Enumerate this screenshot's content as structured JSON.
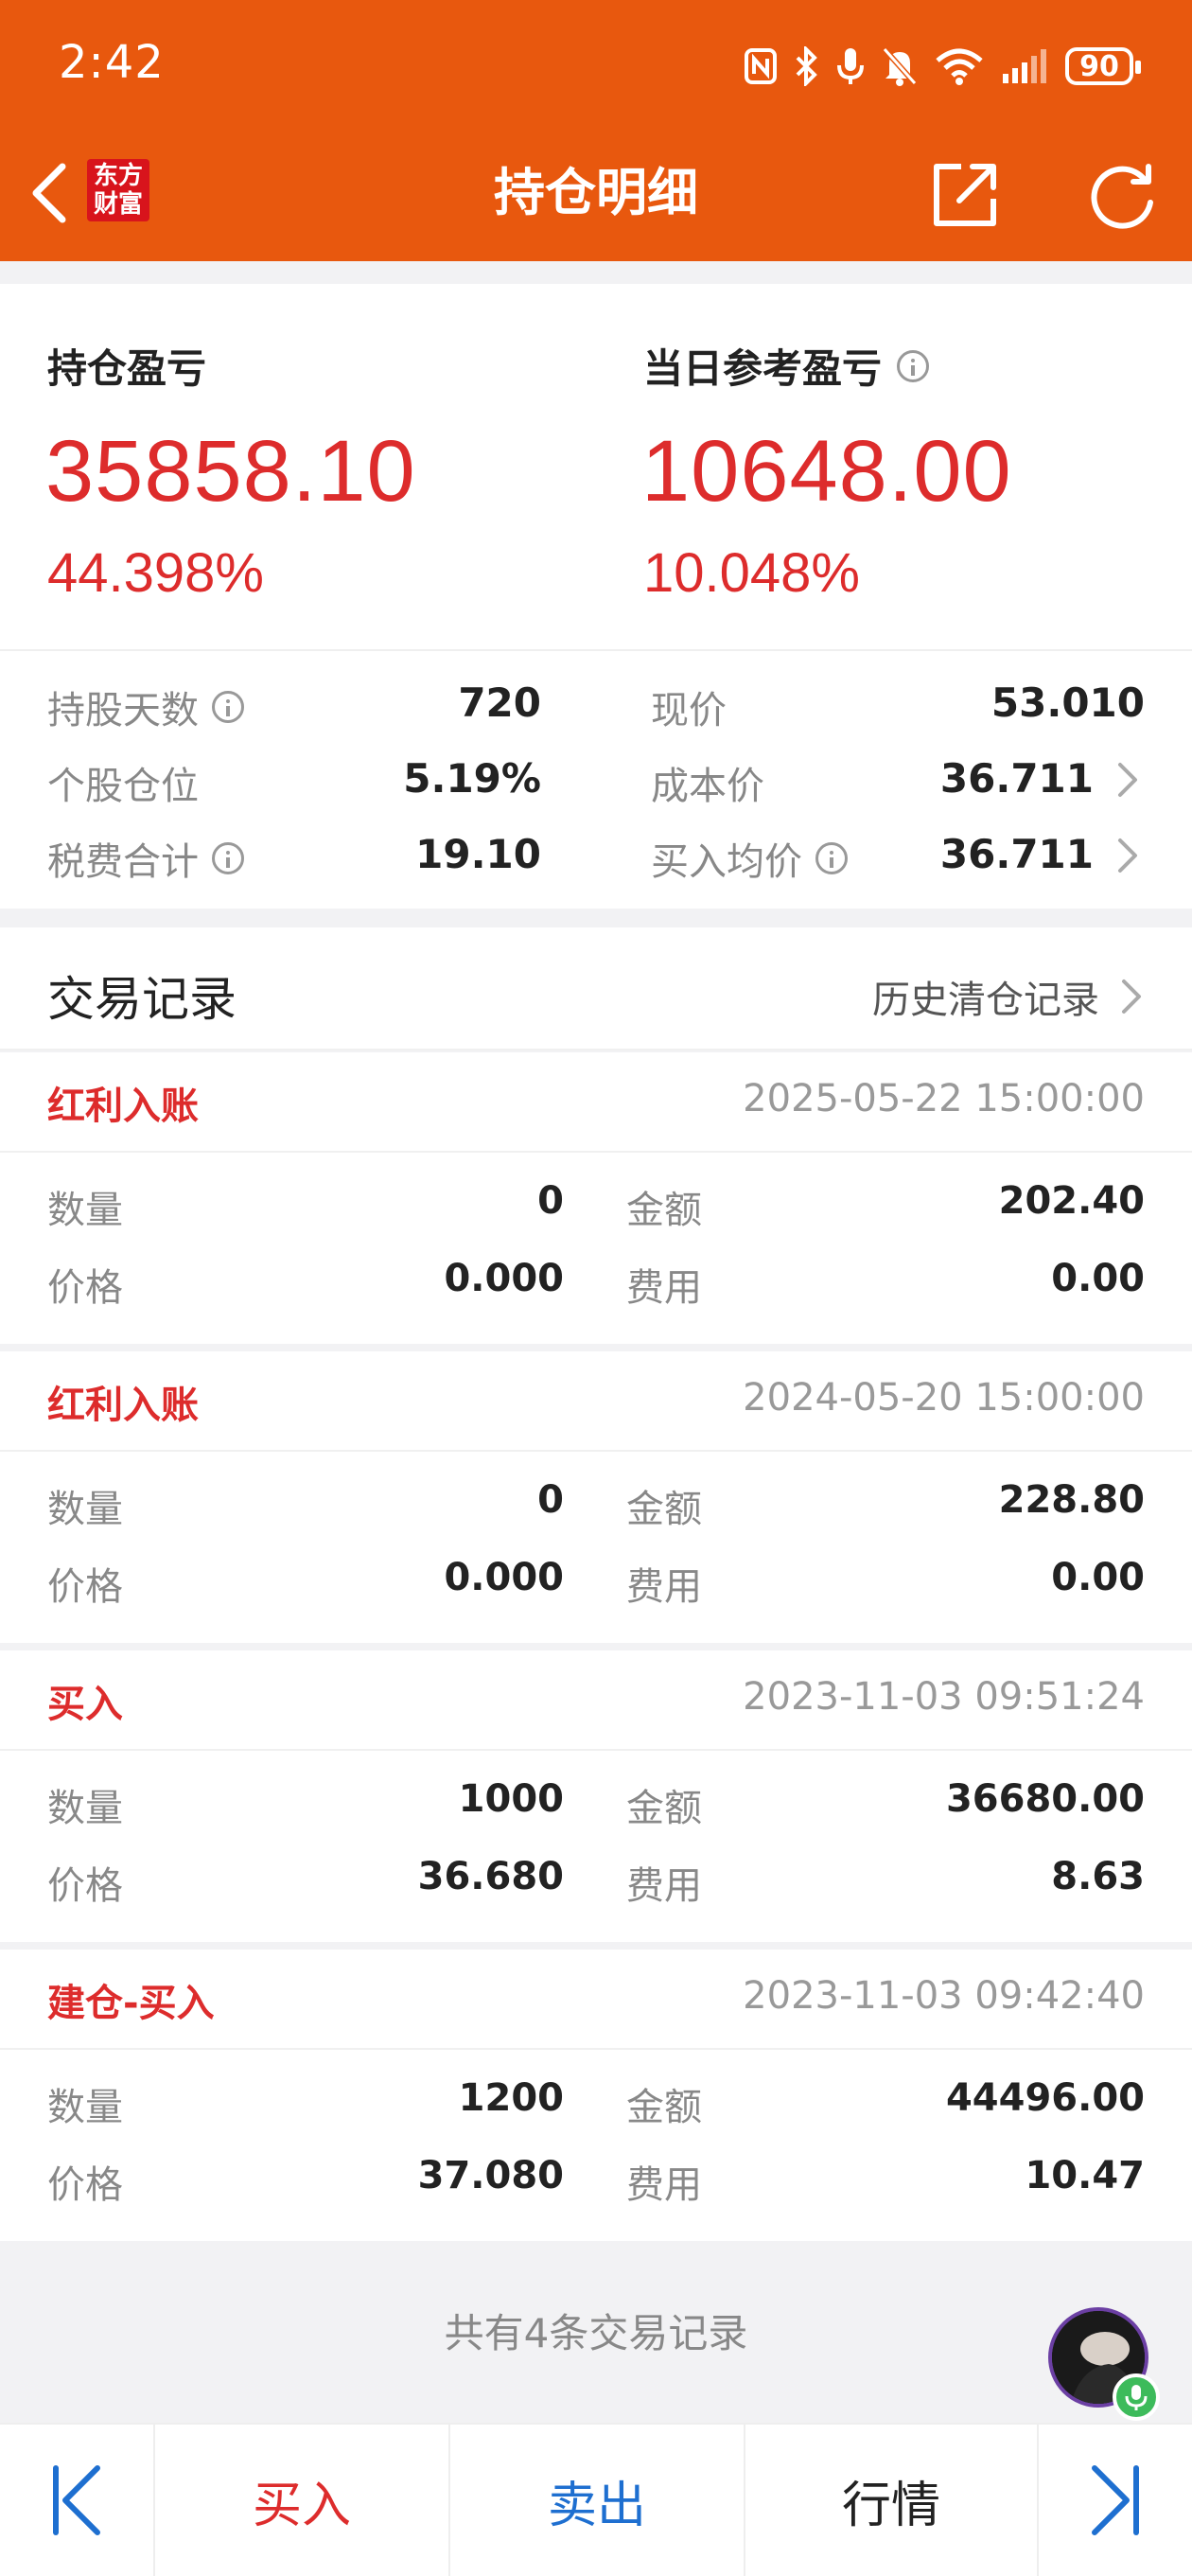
{
  "status_bar": {
    "time": "2:42",
    "battery": "90"
  },
  "header": {
    "logo_line1": "东方",
    "logo_line2": "财富",
    "title": "持仓明细"
  },
  "summary": {
    "position_pl_label": "持仓盈亏",
    "position_pl_value": "35858.10",
    "position_pl_pct": "44.398%",
    "daily_pl_label": "当日参考盈亏",
    "daily_pl_value": "10648.00",
    "daily_pl_pct": "10.048%"
  },
  "stats": {
    "hold_days_label": "持股天数",
    "hold_days_value": "720",
    "position_ratio_label": "个股仓位",
    "position_ratio_value": "5.19%",
    "fees_label": "税费合计",
    "fees_value": "19.10",
    "price_label": "现价",
    "price_value": "53.010",
    "cost_label": "成本价",
    "cost_value": "36.711",
    "avg_buy_label": "买入均价",
    "avg_buy_value": "36.711"
  },
  "records_header": {
    "title": "交易记录",
    "history_link": "历史清仓记录"
  },
  "field_labels": {
    "qty": "数量",
    "price": "价格",
    "amount": "金额",
    "fee": "费用"
  },
  "records": [
    {
      "type": "红利入账",
      "time": "2025-05-22 15:00:00",
      "qty": "0",
      "price": "0.000",
      "amount": "202.40",
      "fee": "0.00"
    },
    {
      "type": "红利入账",
      "time": "2024-05-20 15:00:00",
      "qty": "0",
      "price": "0.000",
      "amount": "228.80",
      "fee": "0.00"
    },
    {
      "type": "买入",
      "time": "2023-11-03 09:51:24",
      "qty": "1000",
      "price": "36.680",
      "amount": "36680.00",
      "fee": "8.63"
    },
    {
      "type": "建仓-买入",
      "time": "2023-11-03 09:42:40",
      "qty": "1200",
      "price": "37.080",
      "amount": "44496.00",
      "fee": "10.47"
    }
  ],
  "footer": {
    "count_text": "共有4条交易记录"
  },
  "bottom_bar": {
    "buy": "买入",
    "sell": "卖出",
    "market": "行情"
  },
  "colors": {
    "brand_orange": "#e8580e",
    "loss_red": "#dd2c2c",
    "sell_blue": "#1e6fd0"
  }
}
